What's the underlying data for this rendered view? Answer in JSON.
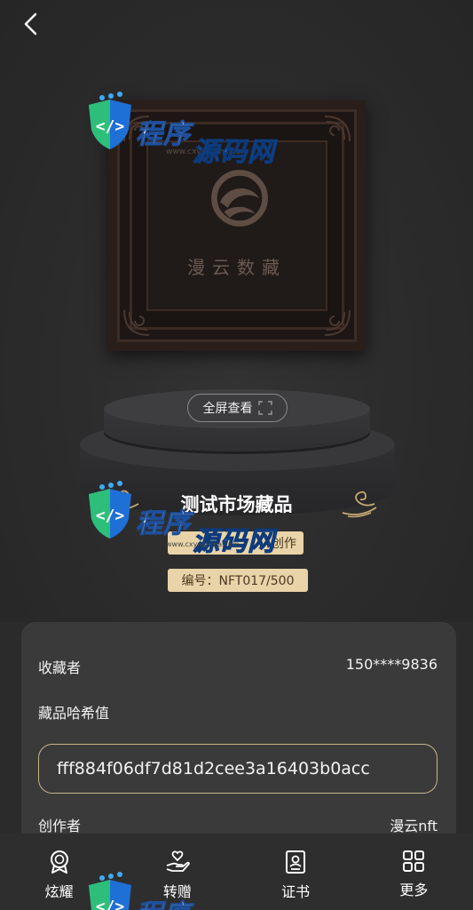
{
  "header": {
    "back_icon": "chevron-left-icon"
  },
  "artwork": {
    "caption": "漫云数藏",
    "watermark_url": "www.cxyuanma.com"
  },
  "actions": {
    "fullscreen_label": "全屏查看",
    "fullscreen_icon": "expand-icon"
  },
  "item": {
    "title": "测试市场藏品",
    "creator_tag": "创作",
    "serial_tag": "编号：NFT017/500"
  },
  "details": {
    "collector_label": "收藏者",
    "collector_value": "150****9836",
    "hash_label": "藏品哈希值",
    "hash_value": "fff884f06df7d81d2cee3a16403b0acc",
    "creator_label": "创作者",
    "creator_value": "漫云nft"
  },
  "watermark": {
    "part1": "程序",
    "part2": "源码网",
    "url": "www.cxyuanma.com"
  },
  "bottom_nav": [
    {
      "label": "炫耀",
      "icon": "medal-icon"
    },
    {
      "label": "转赠",
      "icon": "gift-hand-icon"
    },
    {
      "label": "证书",
      "icon": "certificate-icon"
    },
    {
      "label": "更多",
      "icon": "grid-icon"
    }
  ],
  "colors": {
    "background": "#2b2b2b",
    "card": "#3a3a3a",
    "tag": "#e9d3a8",
    "hash_border": "#c9b48a",
    "watermark_blue": "#1e6fd6"
  }
}
